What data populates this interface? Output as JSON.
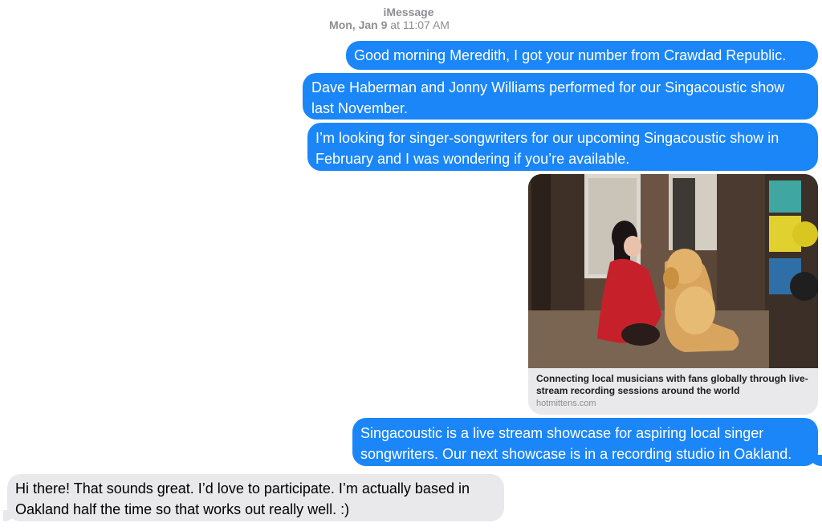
{
  "conversation": {
    "service": "iMessage",
    "timestamp_day": "Mon, Jan 9",
    "timestamp_time": " at 11:07 AM"
  },
  "messages": [
    {
      "from": "me",
      "text": "Good morning Meredith, I got your number from Crawdad Republic."
    },
    {
      "from": "me",
      "text": "Dave Haberman and Jonny Williams performed for our Singacoustic show last November."
    },
    {
      "from": "me",
      "text": "I’m looking for singer-songwriters for our upcoming Singacoustic show in February and I was wondering if you’re available."
    },
    {
      "from": "me",
      "text": "Singacoustic is a live stream showcase for aspiring local singer songwriters. Our next showcase is in a recording studio in Oakland."
    },
    {
      "from": "them",
      "text": "Hi there! That sounds great. I’d love to participate. I’m actually based in Oakland half the time so that works out really well. :)"
    }
  ],
  "link_preview": {
    "title": "Connecting local musicians with fans globally through live-stream recording sessions around the world",
    "site": "hotmittens.com",
    "image_icon": "photo-woman-with-golden-retriever"
  },
  "colors": {
    "outgoing": "#1b86f8",
    "incoming": "#e9e9eb",
    "meta": "#8e8e93"
  }
}
